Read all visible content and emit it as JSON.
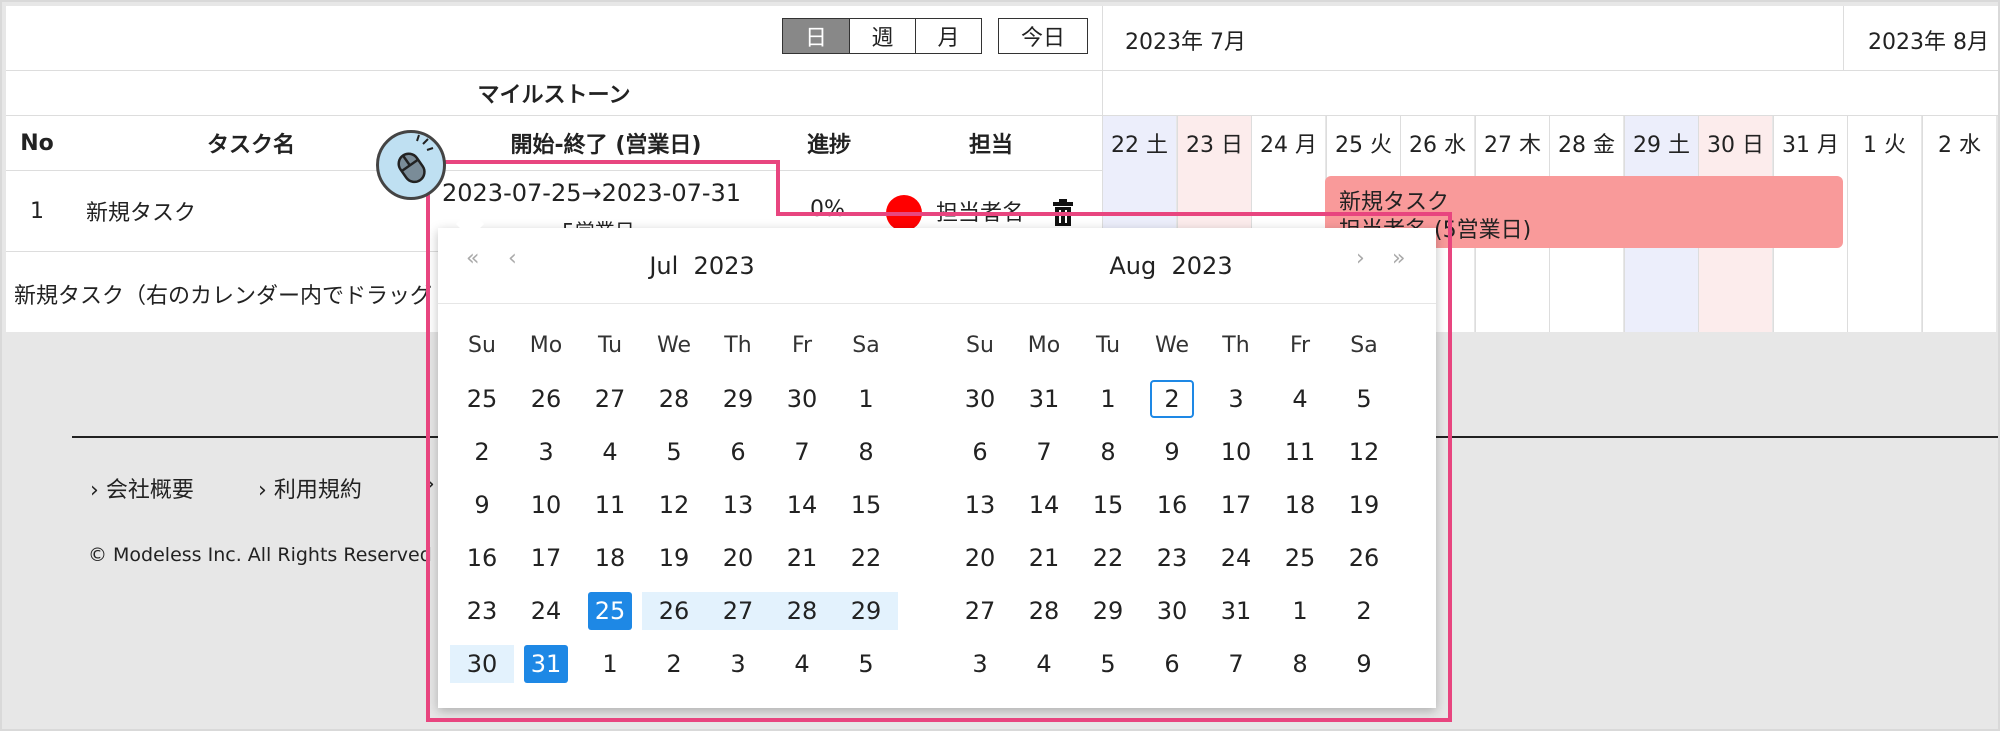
{
  "toolbar": {
    "day": "日",
    "week": "週",
    "month": "月",
    "today": "今日"
  },
  "months": {
    "jul": "2023年 7月",
    "aug": "2023年 8月"
  },
  "milestone_label": "マイルストーン",
  "columns": {
    "no": "No",
    "task": "タスク名",
    "dates": "開始-終了 (営業日)",
    "progress": "進捗",
    "assignee": "担当"
  },
  "days": [
    {
      "label": "22 土",
      "type": "sat"
    },
    {
      "label": "23 日",
      "type": "sun"
    },
    {
      "label": "24 月",
      "type": "wd"
    },
    {
      "label": "25 火",
      "type": "wd"
    },
    {
      "label": "26 水",
      "type": "wd"
    },
    {
      "label": "27 木",
      "type": "wd"
    },
    {
      "label": "28 金",
      "type": "wd"
    },
    {
      "label": "29 土",
      "type": "sat"
    },
    {
      "label": "30 日",
      "type": "sun"
    },
    {
      "label": "31 月",
      "type": "wd"
    },
    {
      "label": "1 火",
      "type": "wd"
    },
    {
      "label": "2 水",
      "type": "wd"
    }
  ],
  "task": {
    "no": "1",
    "name": "新規タスク",
    "start": "2023-07-25",
    "arrow": "→",
    "end": "2023-07-31",
    "business_days": "5営業日",
    "progress": "0%",
    "assignee": "担当者名",
    "assignee_color": "#ff0000"
  },
  "gantt_bar": {
    "title": "新規タスク",
    "subtitle": "担当者名 (5営業日)",
    "color": "#f99a9a"
  },
  "new_task_hint": "新規タスク（右のカレンダー内でドラッグ",
  "footer": {
    "link1": "会社概要",
    "link2": "利用規約",
    "copyright": "© Modeless Inc. All Rights Reserved"
  },
  "datepicker": {
    "left_title": "Jul  2023",
    "right_title": "Aug  2023",
    "nav_prev2": "«",
    "nav_prev": "‹",
    "nav_next": "›",
    "nav_next2": "»",
    "dow": [
      "Su",
      "Mo",
      "Tu",
      "We",
      "Th",
      "Fr",
      "Sa"
    ],
    "left_weeks": [
      [
        "25",
        "26",
        "27",
        "28",
        "29",
        "30",
        "1"
      ],
      [
        "2",
        "3",
        "4",
        "5",
        "6",
        "7",
        "8"
      ],
      [
        "9",
        "10",
        "11",
        "12",
        "13",
        "14",
        "15"
      ],
      [
        "16",
        "17",
        "18",
        "19",
        "20",
        "21",
        "22"
      ],
      [
        "23",
        "24",
        "25",
        "26",
        "27",
        "28",
        "29"
      ],
      [
        "30",
        "31",
        "1",
        "2",
        "3",
        "4",
        "5"
      ]
    ],
    "right_weeks": [
      [
        "30",
        "31",
        "1",
        "2",
        "3",
        "4",
        "5"
      ],
      [
        "6",
        "7",
        "8",
        "9",
        "10",
        "11",
        "12"
      ],
      [
        "13",
        "14",
        "15",
        "16",
        "17",
        "18",
        "19"
      ],
      [
        "20",
        "21",
        "22",
        "23",
        "24",
        "25",
        "26"
      ],
      [
        "27",
        "28",
        "29",
        "30",
        "31",
        "1",
        "2"
      ],
      [
        "3",
        "4",
        "5",
        "6",
        "7",
        "8",
        "9"
      ]
    ],
    "range_start": "25",
    "range_end": "31",
    "today": "3",
    "selected_color": "#1e88e5",
    "range_color": "#e3f2fd"
  },
  "colors": {
    "highlight": "#e8457f",
    "sat_bg": "#eceefb",
    "sun_bg": "#fcecec"
  }
}
